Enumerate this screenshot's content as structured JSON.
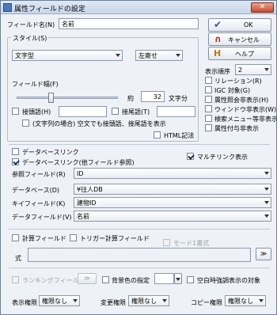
{
  "window": {
    "title": "属性フィールドの設定",
    "close_label": "✕"
  },
  "field_name": {
    "label": "フィールド名(N)",
    "value": "名前"
  },
  "buttons": {
    "ok": "OK",
    "cancel": "キャンセル",
    "help": "ヘルプ"
  },
  "style": {
    "group_label": "スタイル(S)",
    "type_value": "文字型",
    "align_value": "左寄せ",
    "width_label": "フィールド幅(F)",
    "approx_label": "約",
    "width_value": "32",
    "width_unit": "文字分",
    "slider_fraction": 0.33,
    "prefix_label": "接頭語(H)",
    "suffix_label": "接尾語(T)",
    "empty_label": "(文字列の場合) 空文でも接頭語、接尾語を表示",
    "html_label": "HTML記法"
  },
  "display_order": {
    "label": "表示順序",
    "value": "2"
  },
  "side_options": [
    {
      "label": "リレーション(R)",
      "checked": false
    },
    {
      "label": "IGC 対象(G)",
      "checked": false
    },
    {
      "label": "属性照会非表示(H)",
      "checked": false
    },
    {
      "label": "ウィンドウ非表示(W)",
      "checked": false
    },
    {
      "label": "検索メニュー等非表示",
      "checked": false
    },
    {
      "label": "属性付与非表示",
      "checked": false
    }
  ],
  "links": {
    "database_link": "データベースリンク",
    "multi_link": "マルチリンク表示",
    "db_ref_link": "データベースリンク(他フィールド参照)",
    "ref_field_label": "参照フィールド(R)",
    "ref_field_value": "ID",
    "database_label": "データベース(D)",
    "database_value": "¥往人DB",
    "key_field_label": "キイフィールド(K)",
    "key_field_value": "建物ID",
    "data_field_label": "データフィールド(V)",
    "data_field_value": "名前"
  },
  "calc": {
    "calc_label": "計算フィールド",
    "trigger_label": "トリガー計算フィールド",
    "mode_label": "モード1書式",
    "formula_label": "式",
    "more_button": "≫"
  },
  "bottom": {
    "ranking_label": "ランキングフィールド",
    "ranking_button": "≫",
    "bg_label": "背景色の指定",
    "blank_label": "空白時強調表示の対象",
    "view_label": "表示権限",
    "view_value": "権限なし",
    "change_label": "変更権限",
    "change_value": "権限なし",
    "copy_label": "コピー権限",
    "copy_value": "権限なし"
  }
}
